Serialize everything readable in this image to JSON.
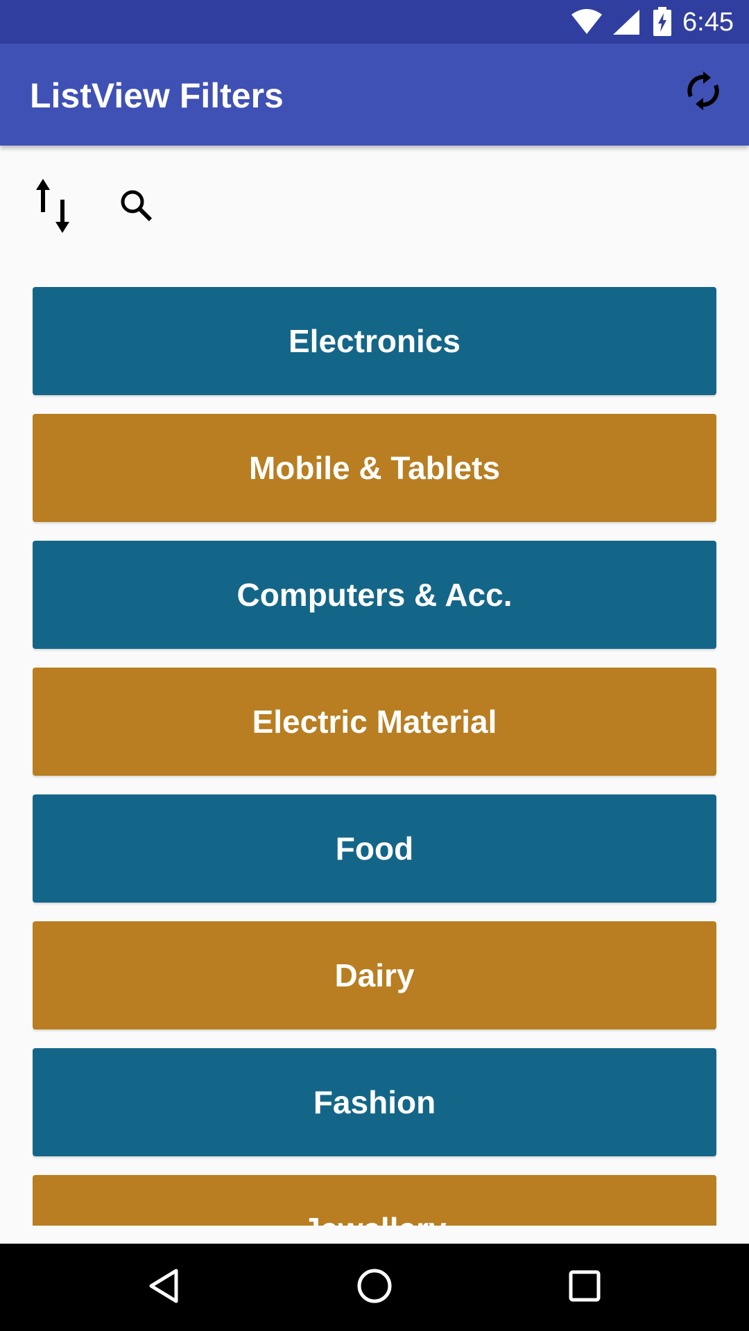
{
  "status_bar": {
    "time": "6:45",
    "icons": [
      "wifi-icon",
      "cell-signal-icon",
      "battery-charging-icon"
    ],
    "color": "#303f9f"
  },
  "app_bar": {
    "title": "ListView Filters",
    "color": "#3f51b5",
    "actions": [
      "refresh-icon"
    ]
  },
  "toolbar": {
    "icons": [
      "sort-icon",
      "search-icon"
    ]
  },
  "list": {
    "colors": {
      "blue": "#146688",
      "gold": "#b87e21"
    },
    "items": [
      {
        "label": "Electronics",
        "color": "#146688"
      },
      {
        "label": "Mobile & Tablets",
        "color": "#b87e21"
      },
      {
        "label": "Computers & Acc.",
        "color": "#146688"
      },
      {
        "label": "Electric Material",
        "color": "#b87e21"
      },
      {
        "label": "Food",
        "color": "#146688"
      },
      {
        "label": "Dairy",
        "color": "#b87e21"
      },
      {
        "label": "Fashion",
        "color": "#146688"
      },
      {
        "label": "Jewellery",
        "color": "#b87e21"
      }
    ]
  },
  "nav_bar": {
    "icons": [
      "back-icon",
      "home-icon",
      "recents-icon"
    ]
  }
}
